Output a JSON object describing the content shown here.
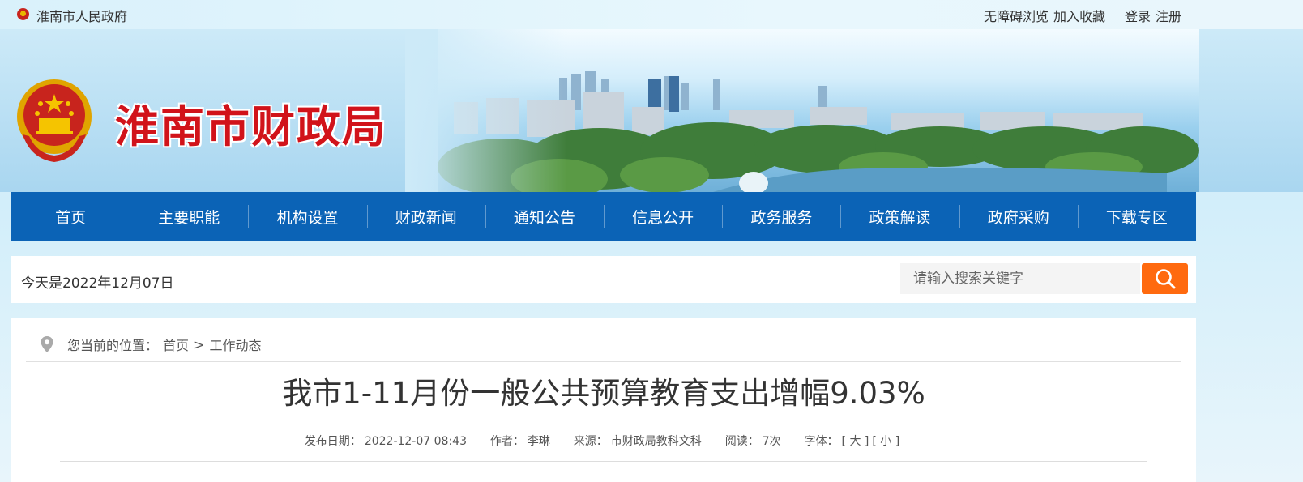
{
  "topbar": {
    "site_name": "淮南市人民政府",
    "links": [
      "无障碍浏览",
      "加入收藏",
      "登录",
      "注册"
    ]
  },
  "banner": {
    "title": "淮南市财政局"
  },
  "nav": {
    "items": [
      "首页",
      "主要职能",
      "机构设置",
      "财政新闻",
      "通知公告",
      "信息公开",
      "政务服务",
      "政策解读",
      "政府采购",
      "下载专区"
    ]
  },
  "strip": {
    "today": "今天是2022年12月07日",
    "search_placeholder": "请输入搜索关键字"
  },
  "breadcrumb": {
    "prefix": "您当前的位置：",
    "home": "首页",
    "sep": ">",
    "current": "工作动态"
  },
  "article": {
    "title": "我市1-11月份一般公共预算教育支出增幅9.03%",
    "meta": {
      "date_label": "发布日期：",
      "date": "2022-12-07 08:43",
      "author_label": "作者：",
      "author": "李琳",
      "source_label": "来源：",
      "source": "市财政局教科文科",
      "reads_label": "阅读：",
      "reads": "7次",
      "font_label": "字体：",
      "font_large": "[ 大 ]",
      "font_small": "[ 小 ]"
    }
  },
  "colors": {
    "nav_bg": "#0b63b6",
    "title_red": "#d1131a",
    "search_button": "#ff6a0f"
  }
}
